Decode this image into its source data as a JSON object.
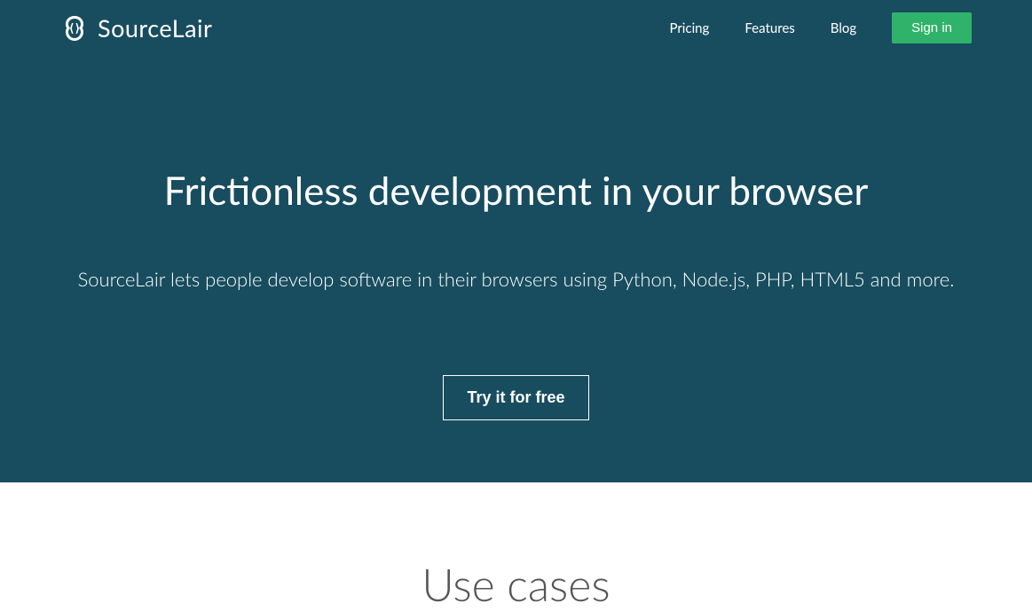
{
  "brand": {
    "name": "SourceLair"
  },
  "nav": {
    "pricing": "Pricing",
    "features": "Features",
    "blog": "Blog",
    "signin": "Sign in"
  },
  "hero": {
    "title": "Frictionless development in your browser",
    "subtitle": "SourceLair lets people develop software in their browsers using Python, Node.js, PHP, HTML5 and more.",
    "cta": "Try it for free"
  },
  "section": {
    "usecases_title": "Use cases"
  }
}
